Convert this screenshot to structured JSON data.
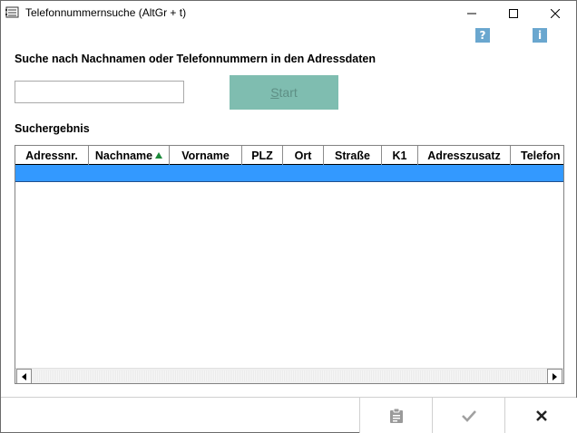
{
  "window": {
    "title": "Telefonnummernsuche (AltGr + t)",
    "icon": "phone-book-icon"
  },
  "toolbar": {
    "help_icon": "?",
    "info_icon": "i"
  },
  "search": {
    "caption": "Suche nach Nachnamen oder Telefonnummern in den Adressdaten",
    "value": "",
    "start_label_underlined": "S",
    "start_label_rest": "tart"
  },
  "results": {
    "caption": "Suchergebnis",
    "columns": [
      "Adressnr.",
      "Nachname",
      "Vorname",
      "PLZ",
      "Ort",
      "Straße",
      "K1",
      "Adresszusatz",
      "Telefon"
    ],
    "sorted_column": "Nachname",
    "rows": []
  },
  "footer": {
    "buttons": [
      "clipboard-icon",
      "checkmark-icon",
      "close-icon"
    ]
  },
  "colors": {
    "start_button_bg": "#7fbdb0",
    "selection": "#3399ff",
    "sort_arrow": "#1c8a3a",
    "help_icon_bg": "#6aa7cf"
  }
}
